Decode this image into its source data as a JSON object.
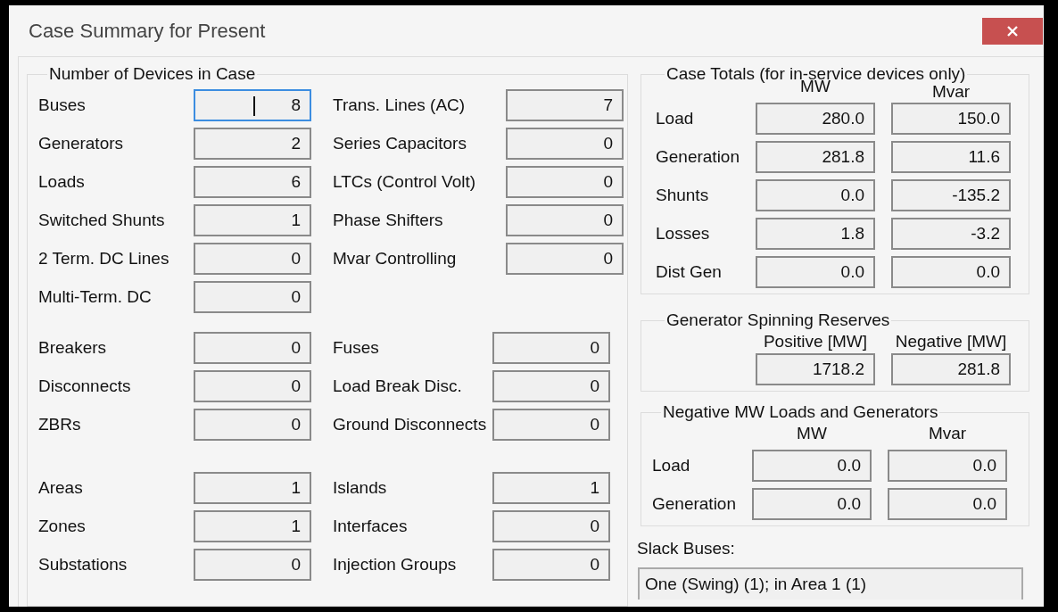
{
  "window": {
    "title": "Case Summary for Present"
  },
  "devices": {
    "title": "Number of Devices in Case",
    "sections": [
      {
        "left": [
          {
            "label": "Buses",
            "value": "8",
            "focused": true
          },
          {
            "label": "Generators",
            "value": "2",
            "focused": false
          },
          {
            "label": "Loads",
            "value": "6",
            "focused": false
          },
          {
            "label": "Switched Shunts",
            "value": "1",
            "focused": false
          },
          {
            "label": "2 Term. DC Lines",
            "value": "0",
            "focused": false
          },
          {
            "label": "Multi-Term. DC",
            "value": "0",
            "focused": false
          }
        ],
        "right": [
          {
            "label": "Trans. Lines (AC)",
            "value": "7",
            "focused": false
          },
          {
            "label": "Series Capacitors",
            "value": "0",
            "focused": false
          },
          {
            "label": "LTCs (Control Volt)",
            "value": "0",
            "focused": false
          },
          {
            "label": "Phase Shifters",
            "value": "0",
            "focused": false
          },
          {
            "label": "Mvar Controlling",
            "value": "0",
            "focused": false
          }
        ]
      },
      {
        "left": [
          {
            "label": "Breakers",
            "value": "0",
            "focused": false
          },
          {
            "label": "Disconnects",
            "value": "0",
            "focused": false
          },
          {
            "label": "ZBRs",
            "value": "0",
            "focused": false
          }
        ],
        "right": [
          {
            "label": "Fuses",
            "value": "0",
            "focused": false
          },
          {
            "label": "Load Break Disc.",
            "value": "0",
            "focused": false
          },
          {
            "label": "Ground Disconnects",
            "value": "0",
            "focused": false
          }
        ]
      },
      {
        "left": [
          {
            "label": "Areas",
            "value": "1",
            "focused": false
          },
          {
            "label": "Zones",
            "value": "1",
            "focused": false
          },
          {
            "label": "Substations",
            "value": "0",
            "focused": false
          }
        ],
        "right": [
          {
            "label": "Islands",
            "value": "1",
            "focused": false
          },
          {
            "label": "Interfaces",
            "value": "0",
            "focused": false
          },
          {
            "label": "Injection Groups",
            "value": "0",
            "focused": false
          }
        ]
      }
    ]
  },
  "case_totals": {
    "title": "Case Totals (for in-service devices only)",
    "columns": [
      "MW",
      "Mvar"
    ],
    "rows": [
      {
        "label": "Load",
        "values": [
          "280.0",
          "150.0"
        ]
      },
      {
        "label": "Generation",
        "values": [
          "281.8",
          "11.6"
        ]
      },
      {
        "label": "Shunts",
        "values": [
          "0.0",
          "-135.2"
        ]
      },
      {
        "label": "Losses",
        "values": [
          "1.8",
          "-3.2"
        ]
      },
      {
        "label": "Dist Gen",
        "values": [
          "0.0",
          "0.0"
        ]
      }
    ]
  },
  "spinning_reserves": {
    "title": "Generator Spinning Reserves",
    "columns": [
      "Positive [MW]",
      "Negative [MW]"
    ],
    "values": [
      "1718.2",
      "281.8"
    ]
  },
  "negative_loads": {
    "title": "Negative MW Loads and Generators",
    "columns": [
      "MW",
      "Mvar"
    ],
    "rows": [
      {
        "label": "Load",
        "values": [
          "0.0",
          "0.0"
        ]
      },
      {
        "label": "Generation",
        "values": [
          "0.0",
          "0.0"
        ]
      }
    ]
  },
  "slack_buses": {
    "label": "Slack Buses:",
    "value": "One (Swing) (1); in Area 1 (1)"
  }
}
